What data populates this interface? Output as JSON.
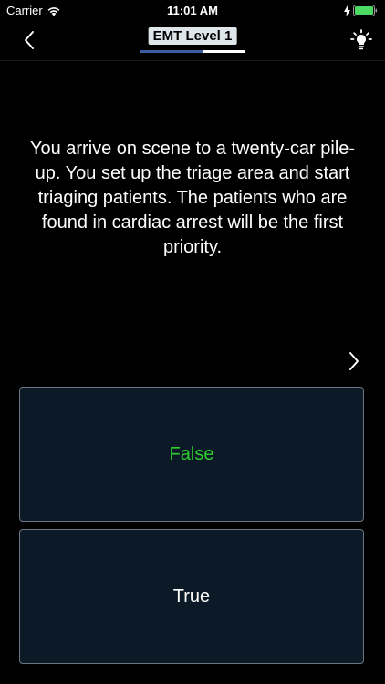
{
  "status_bar": {
    "carrier": "Carrier",
    "time": "11:01 AM"
  },
  "nav": {
    "title": "EMT Level 1",
    "progress_fraction": 0.6,
    "back_icon": "chevron-left-icon",
    "hint_icon": "lightbulb-icon"
  },
  "question": {
    "text": "You arrive on scene to a twenty-car pile-up. You set up the triage area and start triaging patients. The patients who are found in cardiac arrest will be the first priority."
  },
  "answers": [
    {
      "label": "False",
      "color": "#2fce2f"
    },
    {
      "label": "True",
      "color": "#ffffff"
    }
  ],
  "colors": {
    "background": "#000000",
    "card_background": "#0c1a27",
    "card_border": "#6c7680",
    "progress_fill": "#3a5ea0",
    "battery": "#4cd964"
  }
}
